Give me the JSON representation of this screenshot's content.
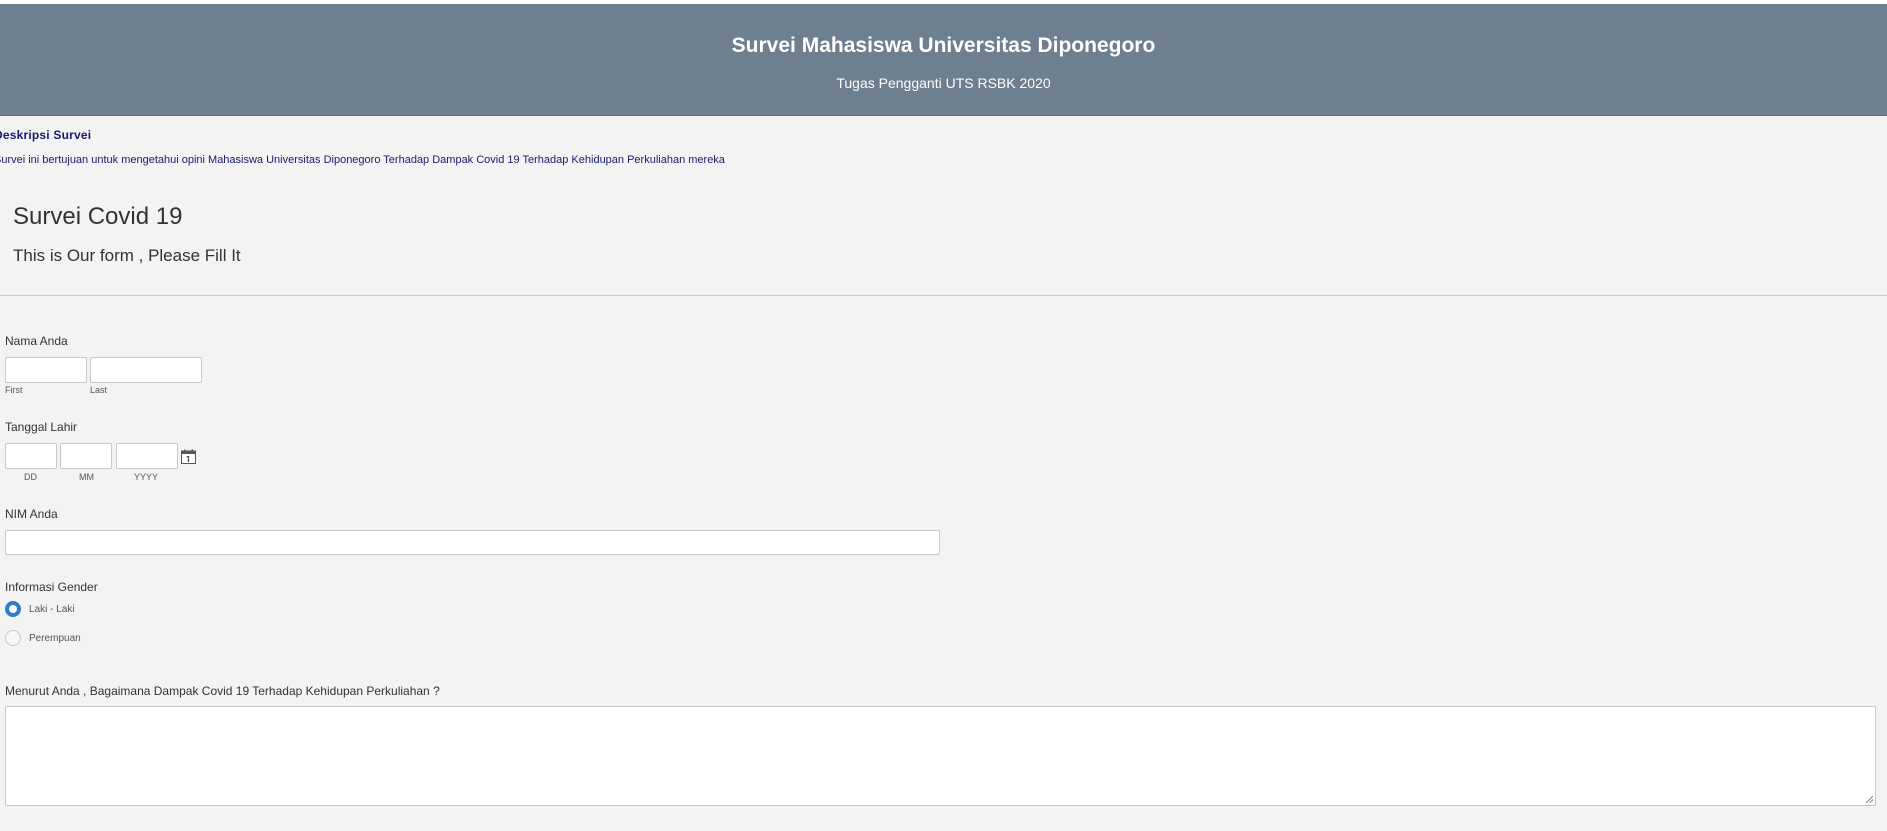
{
  "header": {
    "title": "Survei Mahasiswa Universitas Diponegoro",
    "subtitle": "Tugas Pengganti UTS RSBK 2020"
  },
  "description": {
    "title": "Deskripsi Survei",
    "text": "Survei ini bertujuan untuk mengetahui opini Mahasiswa Universitas Diponegoro Terhadap Dampak Covid 19 Terhadap Kehidupan Perkuliahan mereka"
  },
  "form": {
    "title": "Survei Covid 19",
    "subtitle": "This is Our form , Please Fill It",
    "name": {
      "label": "Nama Anda",
      "first_label": "First",
      "last_label": "Last",
      "first_value": "",
      "last_value": ""
    },
    "birthdate": {
      "label": "Tanggal Lahir",
      "dd_label": "DD",
      "mm_label": "MM",
      "yyyy_label": "YYYY",
      "dd_value": "",
      "mm_value": "",
      "yyyy_value": "",
      "calendar_icon": "calendar-icon"
    },
    "nim": {
      "label": "NIM Anda",
      "value": ""
    },
    "gender": {
      "label": "Informasi Gender",
      "options": [
        "Laki - Laki",
        "Perempuan"
      ],
      "selected": "Laki - Laki"
    },
    "impact": {
      "label": "Menurut Anda , Bagaimana Dampak Covid 19 Terhadap Kehidupan Perkuliahan ?",
      "value": ""
    }
  },
  "colors": {
    "header_bg": "#6e7f90",
    "description_text": "#1a1a6e",
    "radio_selected": "#2e7dc8",
    "page_bg": "#f3f3f3"
  }
}
